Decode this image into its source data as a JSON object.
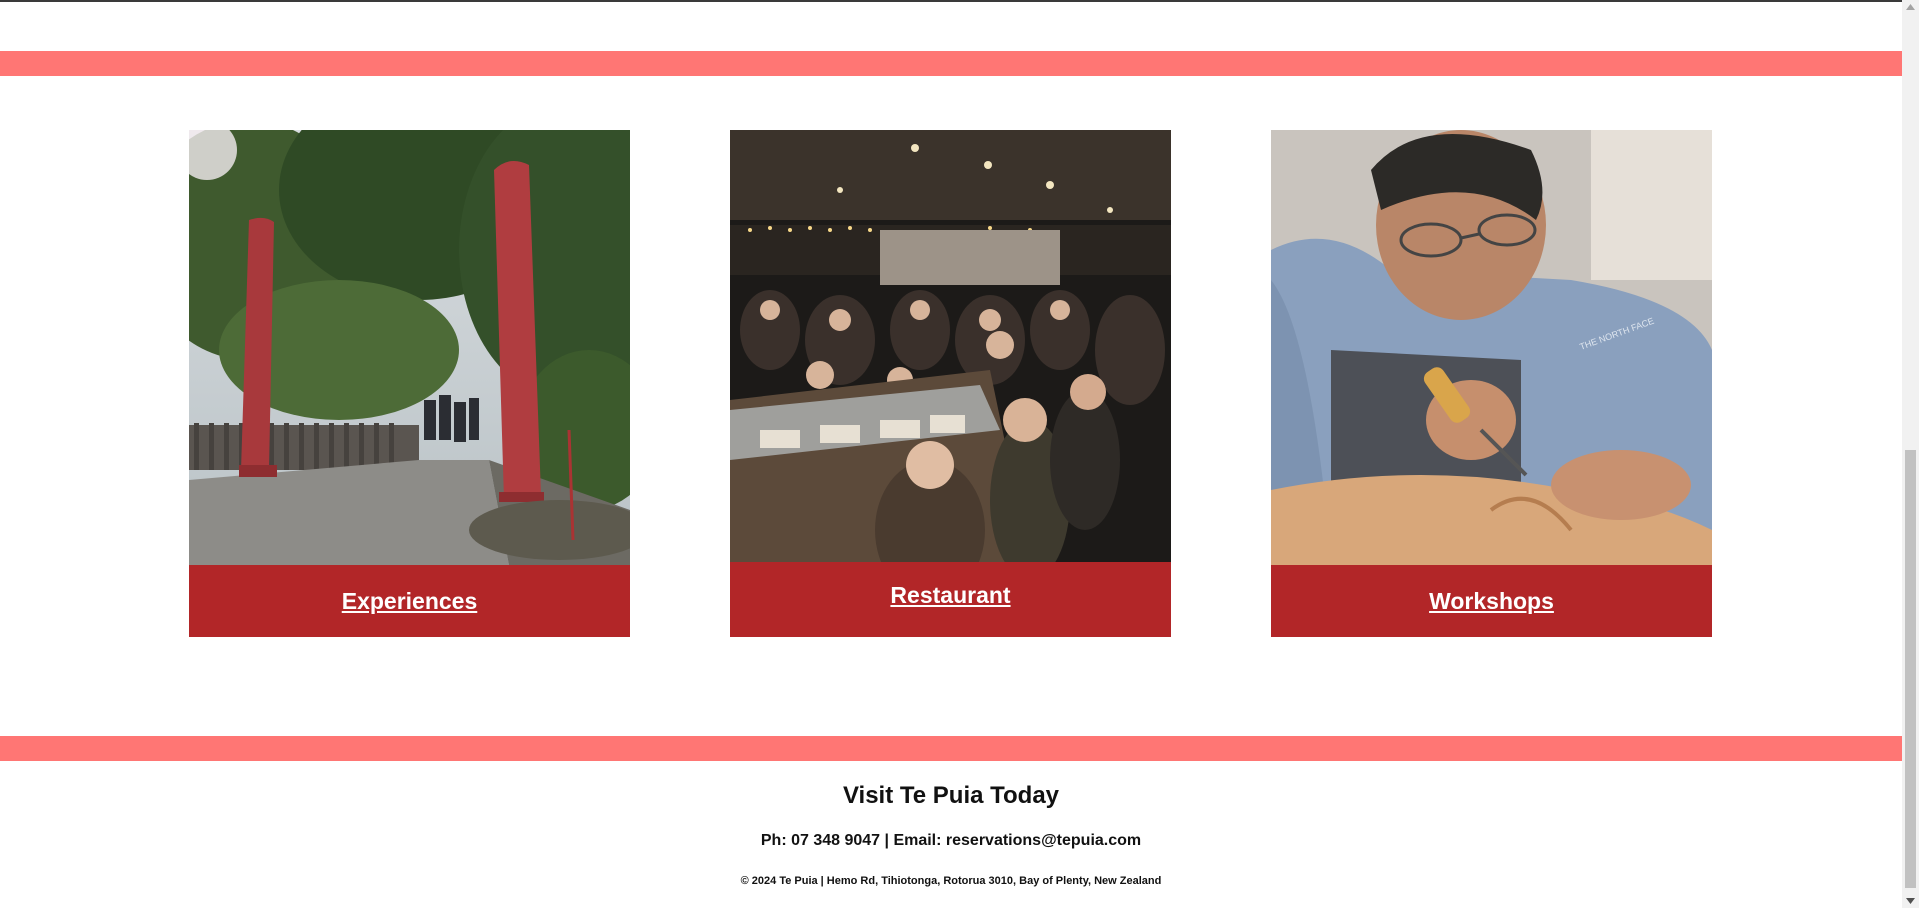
{
  "theme": {
    "band_color": "#ff7674",
    "card_label_bg": "#b22628"
  },
  "cards": [
    {
      "label": "Experiences",
      "photo": "carved-pou-entrance-photo"
    },
    {
      "label": "Restaurant",
      "photo": "buffet-restaurant-photo"
    },
    {
      "label": "Workshops",
      "photo": "wood-carving-workshop-photo"
    }
  ],
  "footer": {
    "title": "Visit Te Puia Today",
    "contact": "Ph: 07 348 9047 | Email: reservations@tepuia.com",
    "copyright": "© 2024 Te Puia | Hemo Rd, Tihiotonga, Rotorua 3010, Bay of Plenty, New Zealand"
  }
}
